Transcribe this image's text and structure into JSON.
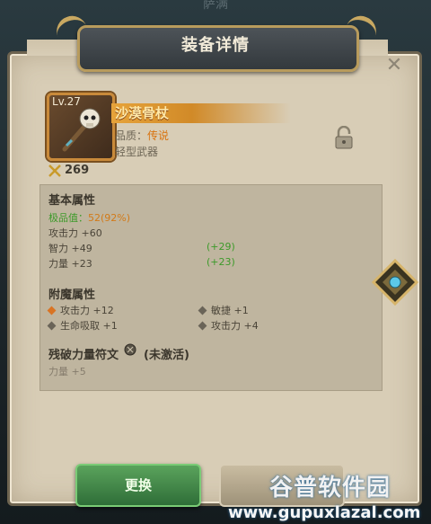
{
  "header": {
    "ghost_title": "萨满"
  },
  "dialog": {
    "title": "装备详情",
    "close_symbol": "✕"
  },
  "item": {
    "level": "Lv.27",
    "name": "沙漠骨杖",
    "quality_label": "品质：",
    "quality_value": "传说",
    "type": "轻型武器",
    "score": "269",
    "icons": {
      "item": "skull-staff-icon",
      "lock": "lock-icon",
      "score": "crossed-swords-icon"
    }
  },
  "basic": {
    "title": "基本属性",
    "excellence_label": "极品值：",
    "excellence_value": "52(92%)",
    "attack": "攻击力 +60",
    "intellect": "智力 +49",
    "intellect_bonus": "(+29)",
    "strength": "力量 +23",
    "strength_bonus": "(+23)"
  },
  "enchant": {
    "title": "附魔属性",
    "e1": "攻击力 +12",
    "e2": "敏捷 +1",
    "e3": "生命吸取 +1",
    "e4": "攻击力 +4"
  },
  "rune": {
    "title": "残破力量符文",
    "status": "(未激活)",
    "effect": "力量 +5"
  },
  "buttons": {
    "replace": "更换"
  },
  "watermark": {
    "brand": "谷普软件园",
    "url": "www.gupuxlazal.com"
  },
  "colors": {
    "panel": "#d8cdb6",
    "accent_gold": "#c9a861",
    "green": "#3d9a2a",
    "orange": "#d27a18",
    "button_green": "#3f8a47"
  }
}
